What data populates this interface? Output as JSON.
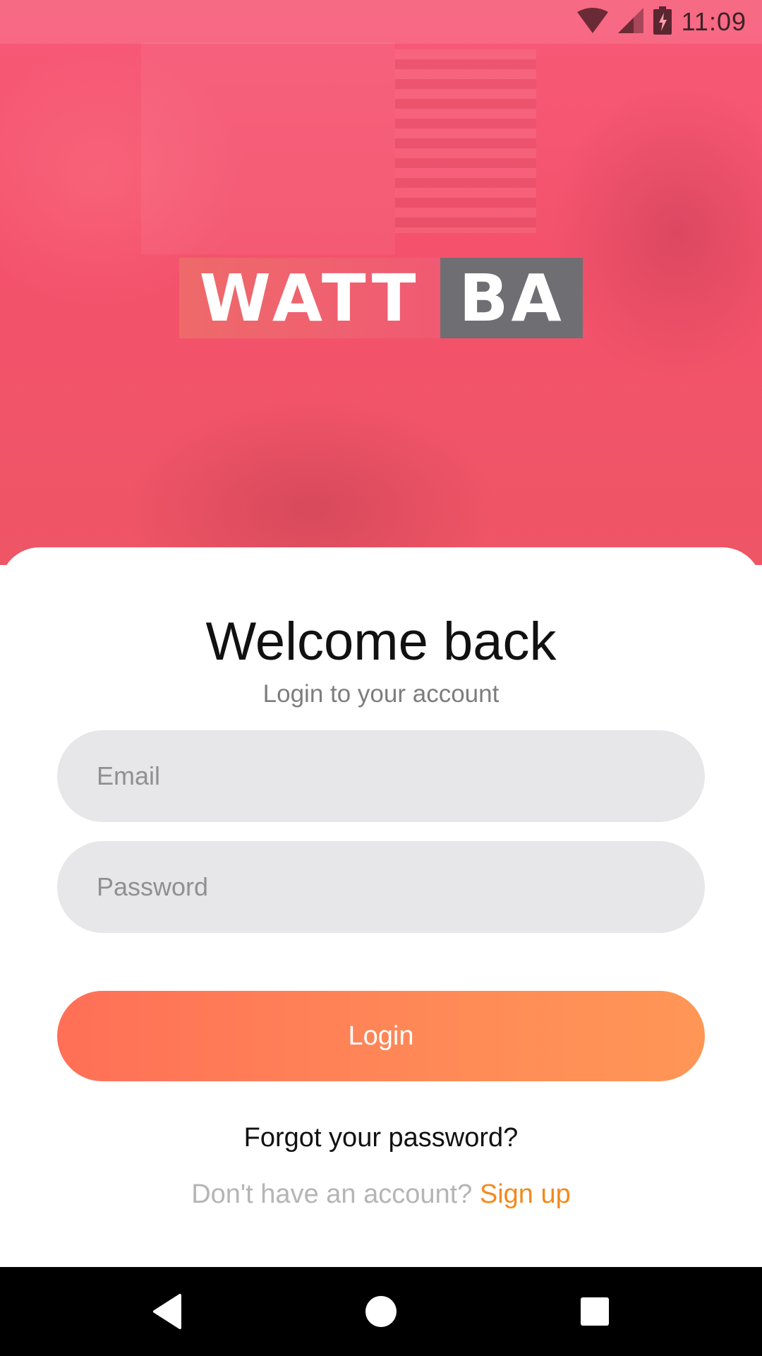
{
  "status_bar": {
    "time": "11:09",
    "icons": [
      "wifi-icon",
      "cell-signal-icon",
      "battery-charging-icon"
    ]
  },
  "logo": {
    "left_text": "WATT",
    "right_text": "BA"
  },
  "login": {
    "title": "Welcome back",
    "subtitle": "Login to your account",
    "email_placeholder": "Email",
    "password_placeholder": "Password",
    "login_label": "Login",
    "forgot_label": "Forgot your password?",
    "no_account_label": "Don't have an account?",
    "signup_label": "Sign up"
  },
  "nav_bar": {
    "icons": [
      "back-icon",
      "home-icon",
      "recents-icon"
    ]
  },
  "colors": {
    "hero": "#f4526c",
    "accent_orange": "#f28a1e",
    "button_start": "#ff6f57",
    "button_end": "#ff9656",
    "field_bg": "#e7e6e8",
    "logo_gray": "#6f6f73"
  }
}
